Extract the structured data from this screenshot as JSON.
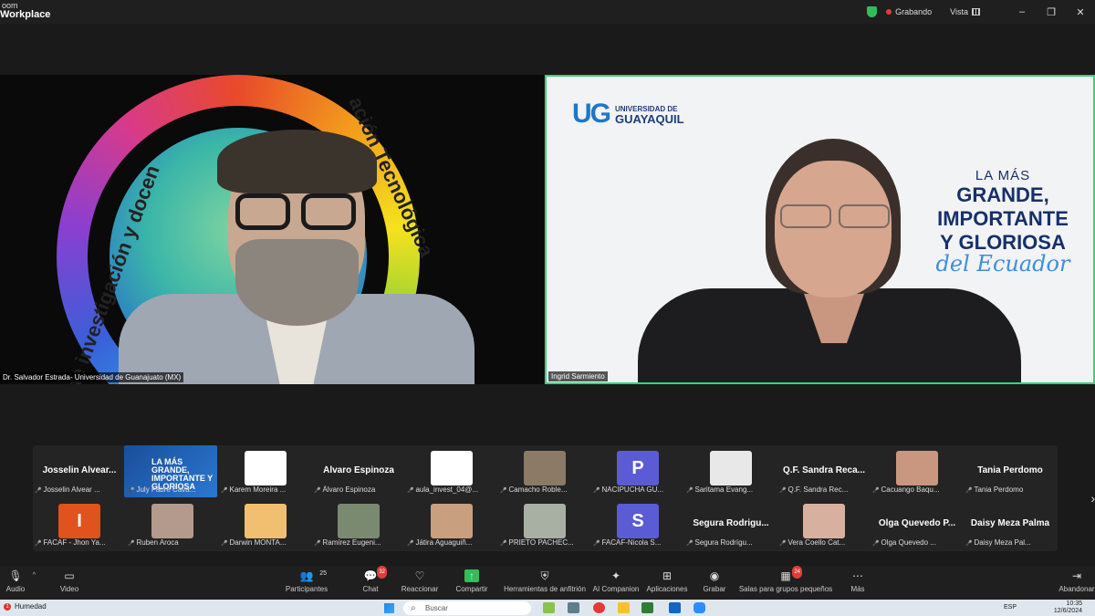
{
  "window": {
    "brand_line1": "oom",
    "brand_line2": "Workplace",
    "recording_label": "Grabando",
    "view_label": "Vista",
    "minimize": "–",
    "restore": "❐",
    "close": "✕"
  },
  "speakers": {
    "left": {
      "name": "Dr. Salvador Estrada- Universidad de Guanajuato (MX)",
      "ring_text_left": "d de investigación y docen",
      "ring_text_right": "ación Tecnológica"
    },
    "right": {
      "name": "Ingrid Sarmiento",
      "logo_mark": "UG",
      "logo_line1": "UNIVERSIDAD DE",
      "logo_line2": "GUAYAQUIL",
      "slogan_1": "LA MÁS",
      "slogan_2": "GRANDE,",
      "slogan_3": "IMPORTANTE",
      "slogan_4": "Y GLORIOSA",
      "slogan_5": "del Ecuador"
    }
  },
  "gallery": {
    "row1": [
      {
        "display": "Josselin  Alvear...",
        "name": "Josselin Alvear ...",
        "type": "text"
      },
      {
        "display": "",
        "name": "July Fabre Cava...",
        "type": "flyer",
        "flyer_text": "LA MÁS GRANDE, IMPORTANTE Y GLORIOSA"
      },
      {
        "display": "UG",
        "name": "Karem Moreira ...",
        "type": "ug"
      },
      {
        "display": "Álvaro  Espinoza",
        "name": "Álvaro Espinoza",
        "type": "text"
      },
      {
        "display": "UG",
        "name": "aula_invest_04@...",
        "type": "ug"
      },
      {
        "display": "",
        "name": "Camacho Roble...",
        "type": "photo",
        "color": "#8a7a66"
      },
      {
        "display": "P",
        "name": "NACIPUCHA GU...",
        "type": "letter",
        "color": "#5b5bd6"
      },
      {
        "display": "",
        "name": "Saritama Evang...",
        "type": "photo",
        "color": "#e8e8e8"
      },
      {
        "display": "Q.F.  Sandra  Reca...",
        "name": "Q.F. Sandra Rec...",
        "type": "text"
      },
      {
        "display": "",
        "name": "Cacuango Baqu...",
        "type": "photo",
        "color": "#c99680"
      },
      {
        "display": "Tania  Perdomo",
        "name": "Tania Perdomo",
        "type": "text"
      }
    ],
    "row2": [
      {
        "display": "I",
        "name": "FACAF - Jhon Ya...",
        "type": "letter",
        "color": "#e0521e"
      },
      {
        "display": "",
        "name": "Ruben Aroca",
        "type": "photo",
        "color": "#b49a8c"
      },
      {
        "display": "",
        "name": "Darwin MONTA...",
        "type": "photo",
        "color": "#f0c070"
      },
      {
        "display": "",
        "name": "Ramírez Eugeni...",
        "type": "photo",
        "color": "#7a8a70"
      },
      {
        "display": "",
        "name": "Játira Aguaguiñ...",
        "type": "photo",
        "color": "#c8a080"
      },
      {
        "display": "",
        "name": "PRIETO PACHEC...",
        "type": "photo",
        "color": "#a8b0a4"
      },
      {
        "display": "S",
        "name": "FACAF-Nicola S...",
        "type": "letter",
        "color": "#5b5bd6"
      },
      {
        "display": "Segura  Rodrigu...",
        "name": "Segura Rodrígu...",
        "type": "text"
      },
      {
        "display": "",
        "name": "Vera Coello Cat...",
        "type": "photo",
        "color": "#d8b0a0"
      },
      {
        "display": "Olga  Quevedo  P...",
        "name": "Olga Quevedo ...",
        "type": "text"
      },
      {
        "display": "Daisy  Meza  Palma",
        "name": "Daisy Meza Pal...",
        "type": "text"
      }
    ]
  },
  "toolbar": {
    "audio": "Audio",
    "video": "Video",
    "participants": "Participantes",
    "participants_count": "25",
    "chat": "Chat",
    "chat_badge": "32",
    "reactions": "Reaccionar",
    "share": "Compartir",
    "host_tools": "Herramientas de anfitrión",
    "ai": "AI Companion",
    "apps": "Aplicaciones",
    "record": "Grabar",
    "breakout": "Salas para grupos pequeños",
    "breakout_badge": "24",
    "more": "Más",
    "leave": "Abandonar"
  },
  "taskbar": {
    "weather_badge": "1",
    "weather": "Humedad",
    "search": "Buscar",
    "lang": "ESP",
    "time": "10:35",
    "date": "12/6/2024"
  },
  "colors": {
    "accent_green": "#3ad17a",
    "recording_red": "#e23b3b",
    "ug_blue": "#1f77c8"
  }
}
